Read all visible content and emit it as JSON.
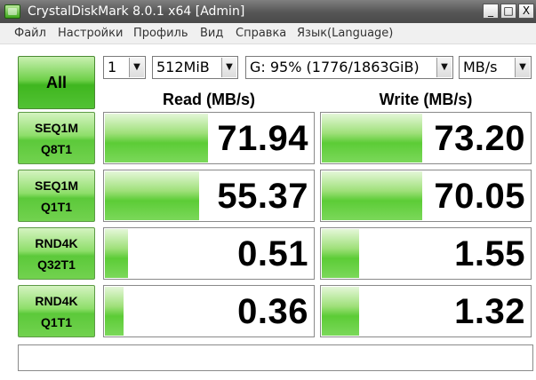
{
  "window": {
    "title": "CrystalDiskMark 8.0.1 x64 [Admin]",
    "controls": {
      "minimize": "_",
      "maximize": "□",
      "close": "X"
    }
  },
  "menu": [
    "Файл",
    "Настройки",
    "Профиль",
    "Вид",
    "Справка",
    "Язык(Language)"
  ],
  "controls": {
    "all_label": "All",
    "count": "1",
    "size": "512MiB",
    "drive": "G: 95% (1776/1863GiB)",
    "unit": "MB/s"
  },
  "headers": {
    "read": "Read (MB/s)",
    "write": "Write (MB/s)"
  },
  "tests": [
    {
      "line1": "SEQ1M",
      "line2": "Q8T1",
      "read": "71.94",
      "write": "73.20",
      "read_fill": 0.49,
      "write_fill": 0.48
    },
    {
      "line1": "SEQ1M",
      "line2": "Q1T1",
      "read": "55.37",
      "write": "70.05",
      "read_fill": 0.45,
      "write_fill": 0.48
    },
    {
      "line1": "RND4K",
      "line2": "Q32T1",
      "read": "0.51",
      "write": "1.55",
      "read_fill": 0.11,
      "write_fill": 0.18
    },
    {
      "line1": "RND4K",
      "line2": "Q1T1",
      "read": "0.36",
      "write": "1.32",
      "read_fill": 0.09,
      "write_fill": 0.18
    }
  ],
  "status": "",
  "colors": {
    "accent_green": "#5ccc36",
    "titlebar": "#555555",
    "menubar": "#f0f0f0"
  }
}
